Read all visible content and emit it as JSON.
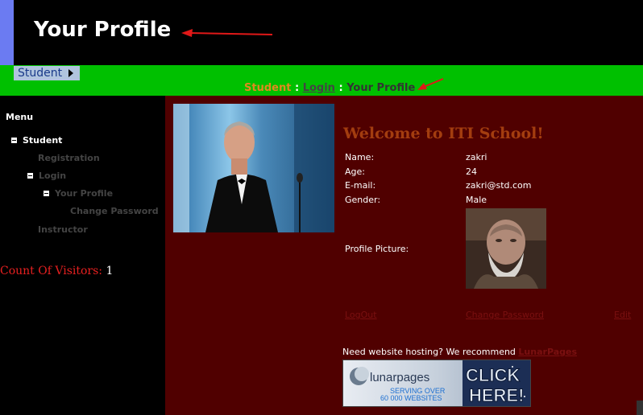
{
  "header": {
    "title": "Your Profile"
  },
  "nav": {
    "student_menu": "Student"
  },
  "breadcrumb": {
    "student": "Student",
    "sep": " : ",
    "login": "Login",
    "current": "Your Profile"
  },
  "sidebar": {
    "menu_title": "Menu",
    "items": [
      {
        "label": "Student"
      },
      {
        "label": "Registration"
      },
      {
        "label": "Login"
      },
      {
        "label": "Your Profile"
      },
      {
        "label": "Change Password"
      },
      {
        "label": "Instructor"
      }
    ],
    "visitors_label": "Count Of Visitors:",
    "visitors_value": "1"
  },
  "main": {
    "welcome": "Welcome to ITI School!",
    "fields": {
      "name_label": "Name:",
      "name_value": "zakri",
      "age_label": "Age:",
      "age_value": "24",
      "email_label": "E-mail:",
      "email_value": "zakri@std.com",
      "gender_label": "Gender:",
      "gender_value": "Male",
      "pic_label": "Profile Picture:"
    },
    "links": {
      "logout": "LogOut",
      "change_password": "Change Password",
      "edit": "Edit"
    },
    "hosting": {
      "text": "Need website hosting? We recommend ",
      "link": "LunarPages"
    },
    "banner": {
      "brand": "lunarpages",
      "line1": "SERVING OVER",
      "line2": "60 000 WEBSITES",
      "cta1": "CLICK",
      "cta2": "HERE!"
    }
  },
  "colors": {
    "green_bar": "#00c000",
    "main_bg": "#500000",
    "accent_orange": "#e08a1e",
    "welcome": "#a33d0f"
  }
}
